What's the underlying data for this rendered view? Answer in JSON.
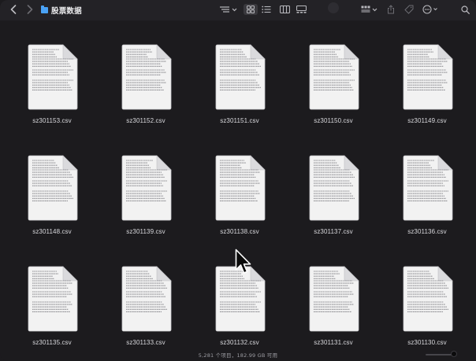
{
  "window": {
    "title": "股票数据",
    "toolbar": {
      "back_icon": "chevron-left-icon",
      "forward_icon": "chevron-right-icon",
      "sort_icon": "sort-lines-icon",
      "view_icons": [
        "grid-view-icon",
        "list-view-icon",
        "column-view-icon",
        "gallery-view-icon"
      ],
      "group_icon": "group-by-icon",
      "share_icon": "share-icon",
      "tag_icon": "tag-icon",
      "more_icon": "ellipsis-circle-icon",
      "search_icon": "search-icon",
      "selected_view": "grid"
    }
  },
  "files": [
    {
      "name": "sz301153.csv"
    },
    {
      "name": "sz301152.csv"
    },
    {
      "name": "sz301151.csv"
    },
    {
      "name": "sz301150.csv"
    },
    {
      "name": "sz301149.csv"
    },
    {
      "name": "sz301148.csv"
    },
    {
      "name": "sz301139.csv"
    },
    {
      "name": "sz301138.csv"
    },
    {
      "name": "sz301137.csv"
    },
    {
      "name": "sz301136.csv"
    },
    {
      "name": "sz301135.csv"
    },
    {
      "name": "sz301133.csv"
    },
    {
      "name": "sz301132.csv"
    },
    {
      "name": "sz301131.csv"
    },
    {
      "name": "sz301130.csv"
    }
  ],
  "status_bar": {
    "text": "5,281 个项目，182.99 GB 可用"
  },
  "colors": {
    "background": "#1c1b1e",
    "toolbar": "#232226",
    "folder_accent": "#4aa2f5",
    "document_page": "#f2f2f2"
  }
}
